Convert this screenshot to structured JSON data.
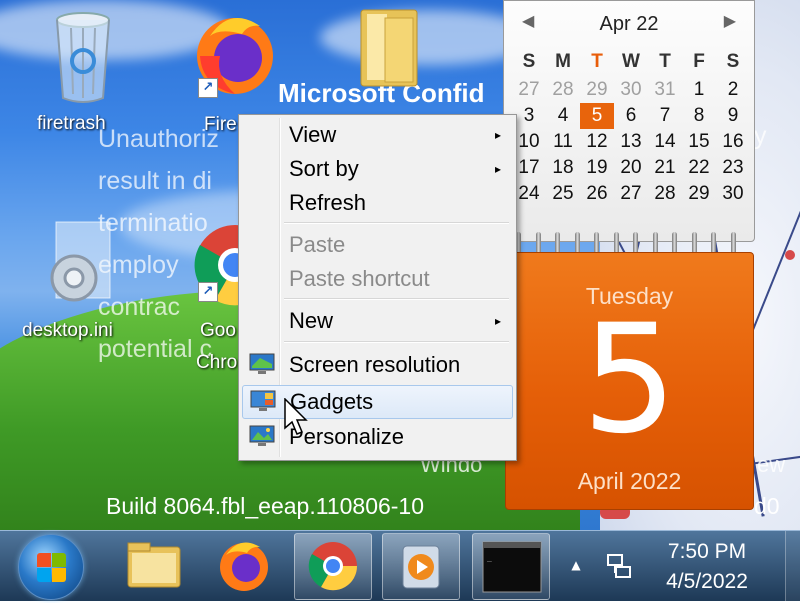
{
  "desktop": {
    "icons": [
      {
        "label": "firetrash"
      },
      {
        "label": "Fire"
      },
      {
        "label": "desktop.ini"
      },
      {
        "label": "Goo"
      },
      {
        "label": "Chro"
      }
    ],
    "watermark": {
      "title": "Microsoft Confid",
      "lines": [
        "Unauthoriz",
        "result in di",
        "terminatio",
        "employ",
        "contrac",
        "potential c"
      ],
      "right_frag_1": "y",
      "right_frag_2": "Windo",
      "right_frag_3": "ew",
      "build": "Build 8064.fbl_eeap.110806-10",
      "build_tail": "d0"
    }
  },
  "context_menu": {
    "items": [
      {
        "label": "View",
        "submenu": true
      },
      {
        "label": "Sort by",
        "submenu": true
      },
      {
        "label": "Refresh"
      },
      {
        "label": "Paste",
        "disabled": true
      },
      {
        "label": "Paste shortcut",
        "disabled": true
      },
      {
        "label": "New",
        "submenu": true
      },
      {
        "label": "Screen resolution",
        "icon": "monitor-icon"
      },
      {
        "label": "Gadgets",
        "icon": "gadgets-icon",
        "highlighted": true
      },
      {
        "label": "Personalize",
        "icon": "personalize-icon"
      }
    ],
    "submenu_arrow": "▸"
  },
  "calendar_gadget": {
    "month_label": "Apr 22",
    "prev": "◀",
    "next": "▶",
    "weekday_headers": [
      "S",
      "M",
      "T",
      "W",
      "T",
      "F",
      "S"
    ],
    "today_header_index": 2,
    "weeks": [
      [
        "27",
        "28",
        "29",
        "30",
        "31",
        "1",
        "2"
      ],
      [
        "3",
        "4",
        "5",
        "6",
        "7",
        "8",
        "9"
      ],
      [
        "10",
        "11",
        "12",
        "13",
        "14",
        "15",
        "16"
      ],
      [
        "17",
        "18",
        "19",
        "20",
        "21",
        "22",
        "23"
      ],
      [
        "24",
        "25",
        "26",
        "27",
        "28",
        "29",
        "30"
      ]
    ],
    "other_month_first_row_count": 5,
    "today_value": "5",
    "big_day_name": "Tuesday",
    "big_date": "5",
    "big_month_year": "April 2022",
    "accent": "#e8640c"
  },
  "taskbar": {
    "clock_time": "7:50 PM",
    "clock_date": "4/5/2022",
    "tray_overflow": "▲",
    "pinned": [
      "file-explorer-icon",
      "firefox-icon",
      "chrome-icon",
      "media-player-icon",
      "cmd-icon"
    ]
  }
}
